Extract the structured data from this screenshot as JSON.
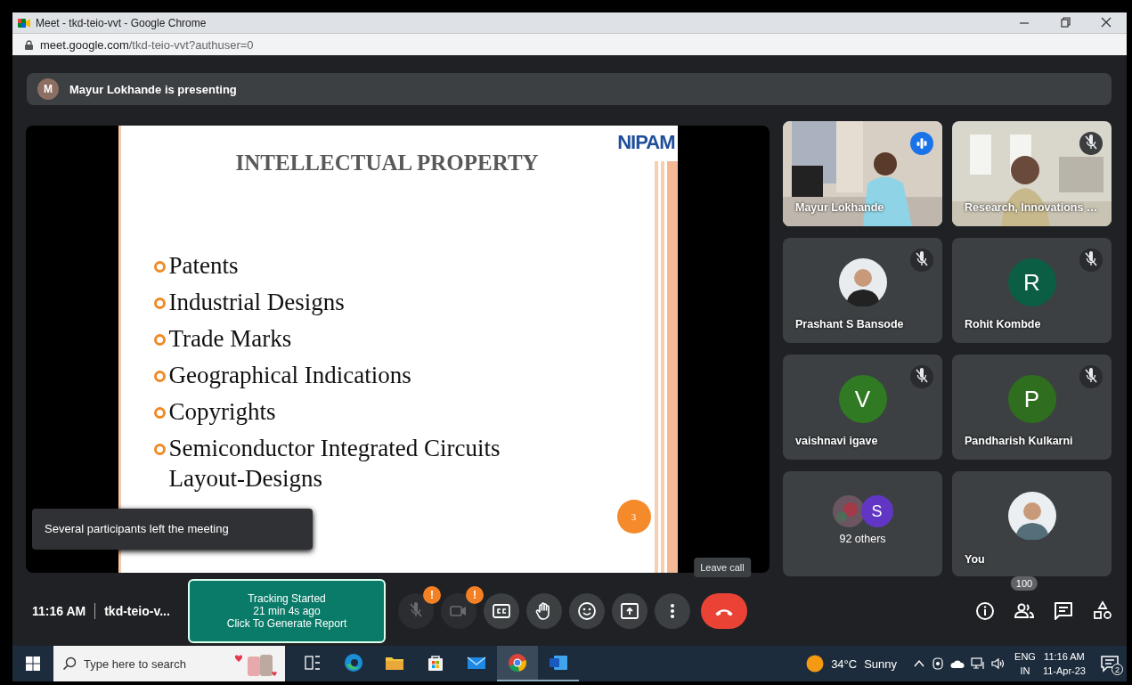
{
  "window": {
    "title": "Meet - tkd-teio-vvt - Google Chrome"
  },
  "address_bar": {
    "host": "meet.google.com",
    "path": "/tkd-teio-vvt?authuser=0"
  },
  "presenting_banner": {
    "initial": "M",
    "text": "Mayur Lokhande is presenting"
  },
  "slide": {
    "logo": "NIPAM",
    "title": "INTELLECTUAL PROPERTY",
    "bullets": [
      "Patents",
      "Industrial Designs",
      "Trade Marks",
      "Geographical Indications",
      "Copyrights",
      "Semiconductor Integrated Circuits Layout-Designs"
    ],
    "page_number": "3"
  },
  "notification": "Several participants left the meeting",
  "tiles": [
    {
      "kind": "video",
      "name": "Mayur Lokhande",
      "speaking": true,
      "muted": false
    },
    {
      "kind": "video",
      "name": "Research, Innovations …",
      "speaking": false,
      "muted": true
    },
    {
      "name": "Prashant S Bansode",
      "speaking": false,
      "muted": true
    },
    {
      "kind": "initial",
      "initial": "R",
      "color": "#0b5e44",
      "name": "Rohit Kombde",
      "speaking": false,
      "muted": true
    },
    {
      "kind": "initial",
      "initial": "V",
      "color": "#2f7a23",
      "name": "vaishnavi igave",
      "speaking": false,
      "muted": true
    },
    {
      "kind": "initial",
      "initial": "P",
      "color": "#2f6e1e",
      "name": "Pandharish Kulkarni",
      "speaking": false,
      "muted": true
    },
    {
      "kind": "others",
      "initial": "S",
      "color": "#6236c4",
      "name": "92 others",
      "speaking": false,
      "muted": false
    },
    {
      "kind": "self",
      "name": "You",
      "speaking": false,
      "muted": false
    }
  ],
  "meeting_bar": {
    "time": "11:16 AM",
    "meeting_code": "tkd-teio-v...",
    "tracking": [
      "Tracking Started",
      "21 min 4s ago",
      "Click To Generate Report"
    ]
  },
  "controls": [
    {
      "kind": "mic",
      "muted": true,
      "badge": "!"
    },
    {
      "kind": "camera",
      "muted": true,
      "badge": "!"
    },
    {
      "kind": "captions",
      "muted": false
    },
    {
      "kind": "hand",
      "muted": false
    },
    {
      "kind": "emoji",
      "muted": false
    },
    {
      "kind": "present",
      "muted": false
    },
    {
      "kind": "more",
      "muted": false
    },
    {
      "kind": "leave",
      "muted": false,
      "tooltip": "Leave call"
    }
  ],
  "side_controls": [
    {
      "kind": "info"
    },
    {
      "kind": "people",
      "badge": "100"
    },
    {
      "kind": "chat"
    },
    {
      "kind": "activities"
    }
  ],
  "taskbar": {
    "search_placeholder": "Type here to search",
    "apps": [
      {
        "kind": "taskview",
        "active": false,
        "running": false
      },
      {
        "kind": "edge",
        "active": false,
        "running": false
      },
      {
        "kind": "folder",
        "active": false,
        "running": false
      },
      {
        "kind": "store",
        "active": false,
        "running": false
      },
      {
        "kind": "mail",
        "active": false,
        "running": false
      },
      {
        "kind": "chrome",
        "active": true,
        "running": true
      },
      {
        "kind": "word",
        "active": false,
        "running": true
      }
    ],
    "weather": {
      "temperature": "34°C",
      "condition": "Sunny"
    },
    "language": [
      "ENG",
      "IN"
    ],
    "time": "11:16 AM",
    "date": "11-Apr-23",
    "notifications": "2"
  }
}
